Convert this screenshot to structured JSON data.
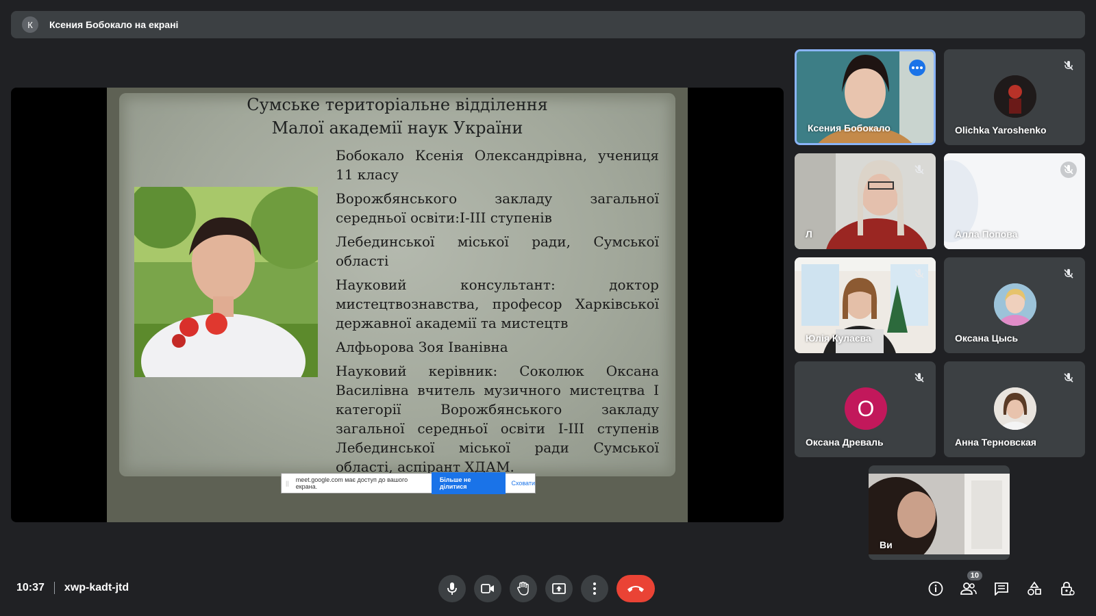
{
  "banner": {
    "avatar_letter": "К",
    "text": "Ксения Бобокало на екрані"
  },
  "slide": {
    "heading_line1": "Сумське територіальне відділення",
    "heading_line2": "Малої академії наук України",
    "paragraphs": [
      "Бобокало Ксенія Олександрівна, учениця 11 класу",
      "Ворожбянського закладу загальної середньої освіти:I-III ступенів",
      "Лебединської міської ради, Сумської області",
      "Науковий консультант: доктор мистецтвознавства, професор Харківської державної академії та мистецтв",
      "Алфьорова Зоя Іванівна",
      "Науковий керівник: Соколюк Оксана Василівна вчитель музичного мистецтва I категорії Ворожбянського закладу загальної середньої освіти I-III ступенів Лебединської міської ради Сумської області, аспірант ХДАМ."
    ]
  },
  "share_bar": {
    "message": "meet.google.com має доступ до вашого екрана.",
    "stop_label": "Більше не ділитися",
    "hide_label": "Сховати"
  },
  "participants": [
    {
      "name": "Ксения Бобокало"
    },
    {
      "name": "Olichka Yaroshenko"
    },
    {
      "name": "Л"
    },
    {
      "name": "Алла Попова"
    },
    {
      "name": "Юлія Кулаєва"
    },
    {
      "name": "Оксана Цысь"
    },
    {
      "name": "Оксана Древаль",
      "initial": "О"
    },
    {
      "name": "Анна Терновская"
    },
    {
      "name": "Ви"
    }
  ],
  "footer": {
    "time": "10:37",
    "meeting_code": "xwp-kadt-jtd",
    "participants_count": "10"
  },
  "colors": {
    "accent": "#8ab4f8",
    "hangup": "#ea4335",
    "avatar_pink": "#c2185b"
  }
}
